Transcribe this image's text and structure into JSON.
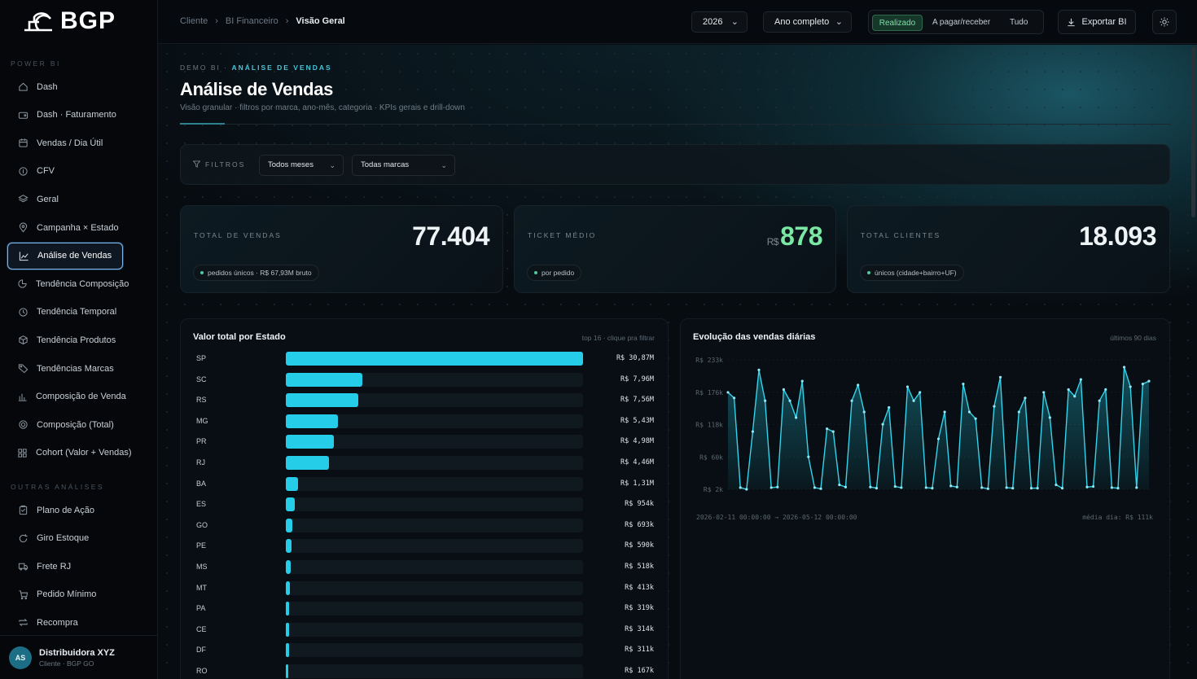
{
  "brand": {
    "name": "BGP"
  },
  "sidebar": {
    "section1": "POWER BI",
    "section2": "OUTRAS ANÁLISES",
    "items": [
      {
        "label": "Dash",
        "icon": "home-icon"
      },
      {
        "label": "Dash · Faturamento",
        "icon": "wallet-icon"
      },
      {
        "label": "Vendas / Dia Útil",
        "icon": "calendar-icon"
      },
      {
        "label": "CFV",
        "icon": "coin-icon"
      },
      {
        "label": "Geral",
        "icon": "layers-icon"
      },
      {
        "label": "Campanha × Estado",
        "icon": "map-pin-icon"
      },
      {
        "label": "Análise de Vendas",
        "icon": "chart-line-icon",
        "active": true
      },
      {
        "label": "Tendência Composição",
        "icon": "pie-icon"
      },
      {
        "label": "Tendência Temporal",
        "icon": "clock-icon"
      },
      {
        "label": "Tendência Produtos",
        "icon": "box-icon"
      },
      {
        "label": "Tendências Marcas",
        "icon": "tag-icon"
      },
      {
        "label": "Composição de Venda",
        "icon": "bar-chart-icon"
      },
      {
        "label": "Composição (Total)",
        "icon": "target-icon"
      },
      {
        "label": "Cohort (Valor + Vendas)",
        "icon": "grid-icon"
      }
    ],
    "items2": [
      {
        "label": "Plano de Ação",
        "icon": "clipboard-icon"
      },
      {
        "label": "Giro Estoque",
        "icon": "refresh-icon"
      },
      {
        "label": "Frete RJ",
        "icon": "truck-icon"
      },
      {
        "label": "Pedido Mínimo",
        "icon": "cart-icon"
      },
      {
        "label": "Recompra",
        "icon": "repeat-icon"
      }
    ],
    "user": {
      "initials": "AS",
      "name": "Distribuidora XYZ",
      "role": "Cliente · BGP GO"
    }
  },
  "topbar": {
    "breadcrumb": [
      "Cliente",
      "BI Financeiro",
      "Visão Geral"
    ],
    "year": "2026",
    "period": "Ano completo",
    "segments": [
      "Realizado",
      "A pagar/receber",
      "Tudo"
    ],
    "export": "Exportar BI"
  },
  "page": {
    "eyebrow_a": "DEMO BI",
    "eyebrow_b": "ANÁLISE DE VENDAS",
    "title": "Análise de Vendas",
    "subtitle": "Visão granular · filtros por marca, ano-mês, categoria · KPIs gerais e drill-down"
  },
  "filters": {
    "label": "FILTROS",
    "months": "Todos meses",
    "brands": "Todas marcas"
  },
  "kpis": [
    {
      "label": "TOTAL DE VENDAS",
      "value": "77.404",
      "prefix": "",
      "note": "pedidos únicos · R$ 67,93M bruto"
    },
    {
      "label": "TICKET MÉDIO",
      "value": "878",
      "prefix": "R$",
      "note": "por pedido"
    },
    {
      "label": "TOTAL CLIENTES",
      "value": "18.093",
      "prefix": "",
      "note": "únicos (cidade+bairro+UF)"
    }
  ],
  "colors": {
    "accent": "#25cde8",
    "green": "#7be7a4",
    "bg": "#080b10"
  },
  "chart_data": [
    {
      "type": "bar",
      "title": "Valor total por Estado",
      "note": "top 16 · clique pra filtrar",
      "categories": [
        "SP",
        "SC",
        "RS",
        "MG",
        "PR",
        "RJ",
        "BA",
        "ES",
        "GO",
        "PE",
        "MS",
        "MT",
        "PA",
        "CE",
        "DF",
        "RO"
      ],
      "values": [
        30.87,
        7.96,
        7.56,
        5.43,
        4.98,
        4.46,
        1.31,
        0.954,
        0.693,
        0.59,
        0.518,
        0.413,
        0.319,
        0.314,
        0.311,
        0.167
      ],
      "unit": "R$ M",
      "labels": [
        "R$ 30,87M",
        "R$ 7,96M",
        "R$ 7,56M",
        "R$ 5,43M",
        "R$ 4,98M",
        "R$ 4,46M",
        "R$ 1,31M",
        "R$ 954k",
        "R$ 693k",
        "R$ 590k",
        "R$ 518k",
        "R$ 413k",
        "R$ 319k",
        "R$ 314k",
        "R$ 311k",
        "R$ 167k"
      ]
    },
    {
      "type": "line",
      "title": "Evolução das vendas diárias",
      "note": "últimos 90 dias",
      "yticks": [
        "R$ 233k",
        "R$ 176k",
        "R$ 118k",
        "R$ 60k",
        "R$ 2k"
      ],
      "ylim": [
        2,
        233
      ],
      "unit": "R$ k",
      "range_label": "2026-02-11 00:00:00 → 2026-05-12 00:00:00",
      "avg_label": "média dia: R$ 111k",
      "values": [
        175,
        165,
        5,
        2,
        105,
        215,
        160,
        5,
        6,
        180,
        160,
        130,
        195,
        60,
        5,
        3,
        110,
        105,
        10,
        6,
        160,
        188,
        140,
        6,
        4,
        118,
        148,
        7,
        5,
        185,
        160,
        175,
        5,
        4,
        92,
        140,
        8,
        6,
        190,
        140,
        128,
        5,
        3,
        150,
        202,
        5,
        4,
        140,
        165,
        4,
        4,
        175,
        130,
        10,
        4,
        180,
        168,
        198,
        6,
        7,
        160,
        180,
        5,
        4,
        220,
        185,
        5,
        190,
        195
      ]
    }
  ]
}
